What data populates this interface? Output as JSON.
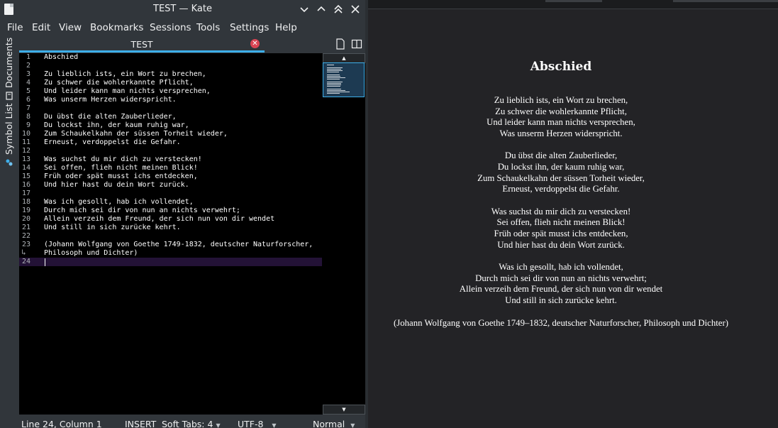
{
  "window": {
    "title": "TEST — Kate"
  },
  "menu": [
    "File",
    "Edit",
    "View",
    "Bookmarks",
    "Sessions",
    "Tools",
    "Settings",
    "Help"
  ],
  "sidebar": {
    "tabs": [
      "Documents",
      "Symbol List"
    ]
  },
  "tab": {
    "label": "TEST"
  },
  "editor": {
    "lines": [
      {
        "n": "1",
        "text": "Abschied"
      },
      {
        "n": "2",
        "text": ""
      },
      {
        "n": "3",
        "text": "Zu lieblich ists, ein Wort zu brechen,"
      },
      {
        "n": "4",
        "text": "Zu schwer die wohlerkannte Pflicht,"
      },
      {
        "n": "5",
        "text": "Und leider kann man nichts versprechen,"
      },
      {
        "n": "6",
        "text": "Was unserm Herzen widerspricht."
      },
      {
        "n": "7",
        "text": ""
      },
      {
        "n": "8",
        "text": "Du übst die alten Zauberlieder,"
      },
      {
        "n": "9",
        "text": "Du lockst ihn, der kaum ruhig war,"
      },
      {
        "n": "10",
        "text": "Zum Schaukelkahn der süssen Torheit wieder,"
      },
      {
        "n": "11",
        "text": "Erneust, verdoppelst die Gefahr."
      },
      {
        "n": "12",
        "text": ""
      },
      {
        "n": "13",
        "text": "Was suchst du mir dich zu verstecken!"
      },
      {
        "n": "14",
        "text": "Sei offen, flieh nicht meinen Blick!"
      },
      {
        "n": "15",
        "text": "Früh oder spät musst ichs entdecken,"
      },
      {
        "n": "16",
        "text": "Und hier hast du dein Wort zurück."
      },
      {
        "n": "17",
        "text": ""
      },
      {
        "n": "18",
        "text": "Was ich gesollt, hab ich vollendet,"
      },
      {
        "n": "19",
        "text": "Durch mich sei dir von nun an nichts verwehrt;"
      },
      {
        "n": "20",
        "text": "Allein verzeih dem Freund, der sich nun von dir wendet"
      },
      {
        "n": "21",
        "text": "Und still in sich zurücke kehrt."
      },
      {
        "n": "22",
        "text": ""
      },
      {
        "n": "23",
        "text": "(Johann Wolfgang von Goethe 1749-1832, deutscher Naturforscher,"
      },
      {
        "n": "",
        "text": "Philosoph und Dichter)"
      },
      {
        "n": "24",
        "text": ""
      }
    ]
  },
  "status": {
    "position": "Line 24, Column 1",
    "mode": "INSERT",
    "indent": "Soft Tabs: 4",
    "encoding": "UTF-8",
    "highlight": "Normal"
  },
  "preview": {
    "title": "Abschied",
    "lines": [
      "Zu lieblich ists, ein Wort zu brechen,",
      "Zu schwer die wohlerkannte Pflicht,",
      "Und leider kann man nichts versprechen,",
      "Was unserm Herzen widerspricht.",
      "Du übst die alten Zauberlieder,",
      "Du lockst ihn, der kaum ruhig war,",
      "Zum Schaukelkahn der süssen Torheit wieder,",
      "Erneust, verdoppelst die Gefahr.",
      "Was suchst du mir dich zu verstecken!",
      "Sei offen, flieh nicht meinen Blick!",
      "Früh oder spät musst ichs entdecken,",
      "Und hier hast du dein Wort zurück.",
      "Was ich gesollt, hab ich vollendet,",
      "Durch mich sei dir von nun an nichts verwehrt;",
      "Allein verzeih dem Freund, der sich nun von dir wendet",
      "Und still in sich zurücke kehrt.",
      "(Johann Wolfgang von Goethe 1749–1832, deutscher Naturforscher, Philosoph und Dichter)"
    ]
  },
  "colors": {
    "accent": "#3daee9",
    "close": "#da4453",
    "current_line": "#231236",
    "editor_bg": "#000000",
    "preview_bg": "#232326"
  },
  "icons": [
    "app-document-icon",
    "minimize-chevron-icon",
    "maximize-chevron-icon",
    "keep-above-icon",
    "close-icon",
    "tab-close-icon",
    "new-document-icon",
    "split-view-icon",
    "documents-icon",
    "symbol-list-icon",
    "word-wrap-icon"
  ]
}
